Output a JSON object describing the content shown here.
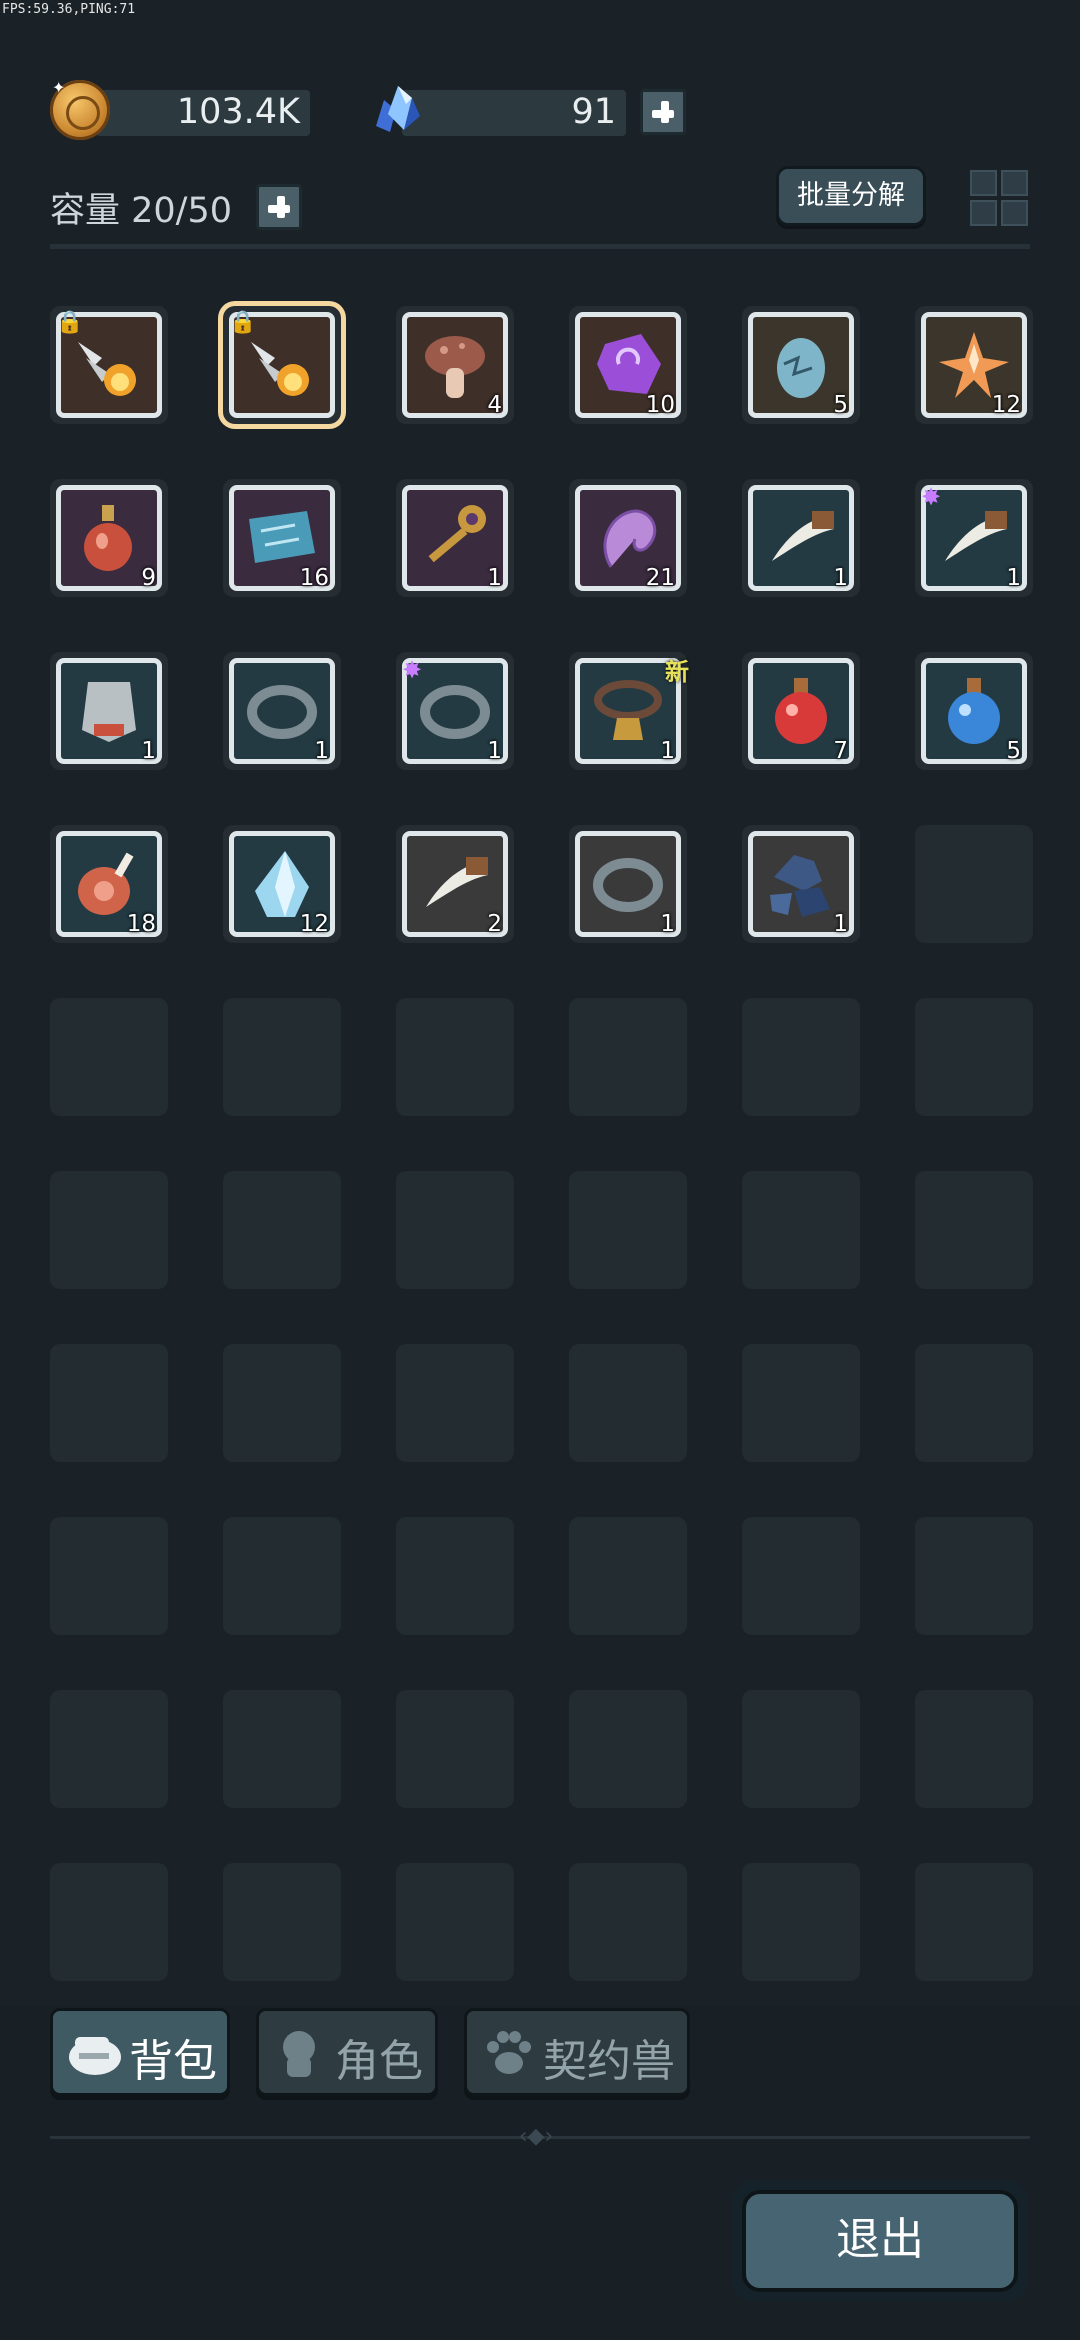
{
  "status": {
    "fps_text": "FPS:59.36,PING:71"
  },
  "currency": {
    "gold": "103.4K",
    "gems": "91"
  },
  "inventory_header": {
    "capacity": "容量 20/50",
    "batch_decompose": "批量分解"
  },
  "items": [
    {
      "name": "flame-arrow-icon",
      "quality": "orange",
      "qty": "",
      "locked": true,
      "selected": false
    },
    {
      "name": "flame-arrow-icon",
      "quality": "orange",
      "qty": "",
      "locked": true,
      "selected": true
    },
    {
      "name": "mushroom-icon",
      "quality": "orange",
      "qty": "4"
    },
    {
      "name": "purple-rune-stone-icon",
      "quality": "orange",
      "qty": "10"
    },
    {
      "name": "dragon-egg-icon",
      "quality": "gold",
      "qty": "5"
    },
    {
      "name": "star-crystal-icon",
      "quality": "gold",
      "qty": "12"
    },
    {
      "name": "red-elixir-flask-icon",
      "quality": "purple",
      "qty": "9"
    },
    {
      "name": "map-scroll-icon",
      "quality": "purple",
      "qty": "16"
    },
    {
      "name": "golden-key-icon",
      "quality": "purple",
      "qty": "1"
    },
    {
      "name": "purple-shell-icon",
      "quality": "purple",
      "qty": "21"
    },
    {
      "name": "fang-icon",
      "quality": "blue",
      "qty": "1"
    },
    {
      "name": "fang-icon",
      "quality": "blue",
      "qty": "1",
      "sparkle": true
    },
    {
      "name": "armor-vest-icon",
      "quality": "blue",
      "qty": "1"
    },
    {
      "name": "ring-icon",
      "quality": "blue",
      "qty": "1"
    },
    {
      "name": "ring-icon",
      "quality": "blue",
      "qty": "1",
      "sparkle": true
    },
    {
      "name": "bell-collar-icon",
      "quality": "blue",
      "qty": "1",
      "new": "新"
    },
    {
      "name": "red-potion-icon",
      "quality": "blue",
      "qty": "7"
    },
    {
      "name": "blue-potion-icon",
      "quality": "blue",
      "qty": "5"
    },
    {
      "name": "meat-icon",
      "quality": "blue",
      "qty": "18"
    },
    {
      "name": "ice-crystal-icon",
      "quality": "blue",
      "qty": "12"
    },
    {
      "name": "fang-icon",
      "quality": "white",
      "qty": "2"
    },
    {
      "name": "ring-icon",
      "quality": "white",
      "qty": "1"
    },
    {
      "name": "ore-chunk-icon",
      "quality": "white",
      "qty": "1"
    }
  ],
  "tabs": {
    "bag": "背包",
    "role": "角色",
    "pet": "契约兽"
  },
  "exit": "退出",
  "colors": {
    "background": "#1a2227",
    "orange_quality": "#d8783a",
    "gold_quality": "#c9a150",
    "purple_quality": "#a45fb8",
    "blue_quality": "#43a7c7",
    "white_quality": "#e8e8e8",
    "new_tag": "#e7e05b"
  }
}
